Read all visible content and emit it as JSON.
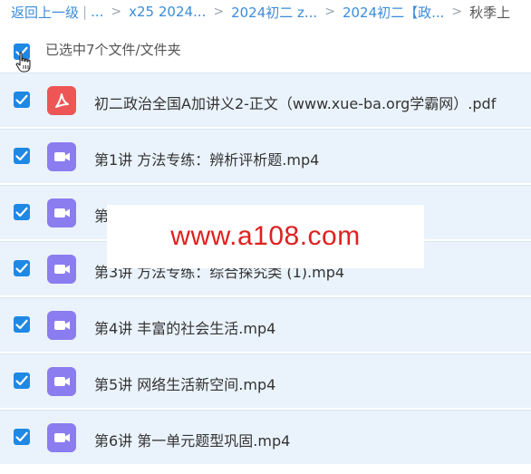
{
  "breadcrumb": {
    "back": "返回上一级",
    "sep": "|",
    "ellipsis": "...",
    "items": [
      "x25 2024...",
      "2024初二 z...",
      "2024初二【政..."
    ],
    "current": "秋季上"
  },
  "selection": {
    "label": "已选中7个文件/文件夹"
  },
  "files": [
    {
      "name": "初二政治全国A加讲义2-正文（www.xue-ba.org学霸网）.pdf",
      "type": "pdf",
      "icon": "pdf-icon"
    },
    {
      "name": "第1讲 方法专练：辨析评析题.mp4",
      "type": "video",
      "icon": "video-icon"
    },
    {
      "name": "第2讲",
      "type": "video",
      "icon": "video-icon"
    },
    {
      "name": "第3讲 方法专练：综合探究类 (1).mp4",
      "type": "video",
      "icon": "video-icon"
    },
    {
      "name": "第4讲 丰富的社会生活.mp4",
      "type": "video",
      "icon": "video-icon"
    },
    {
      "name": "第5讲 网络生活新空间.mp4",
      "type": "video",
      "icon": "video-icon"
    },
    {
      "name": "第6讲 第一单元题型巩固.mp4",
      "type": "video",
      "icon": "video-icon"
    }
  ],
  "watermark": "www.a108.com",
  "colors": {
    "accent": "#1e88e5",
    "link": "#3b8cdb",
    "row_bg": "#eaf3fb",
    "pdf": "#ee5555",
    "video": "#8b7cf0",
    "watermark": "#e02020"
  }
}
